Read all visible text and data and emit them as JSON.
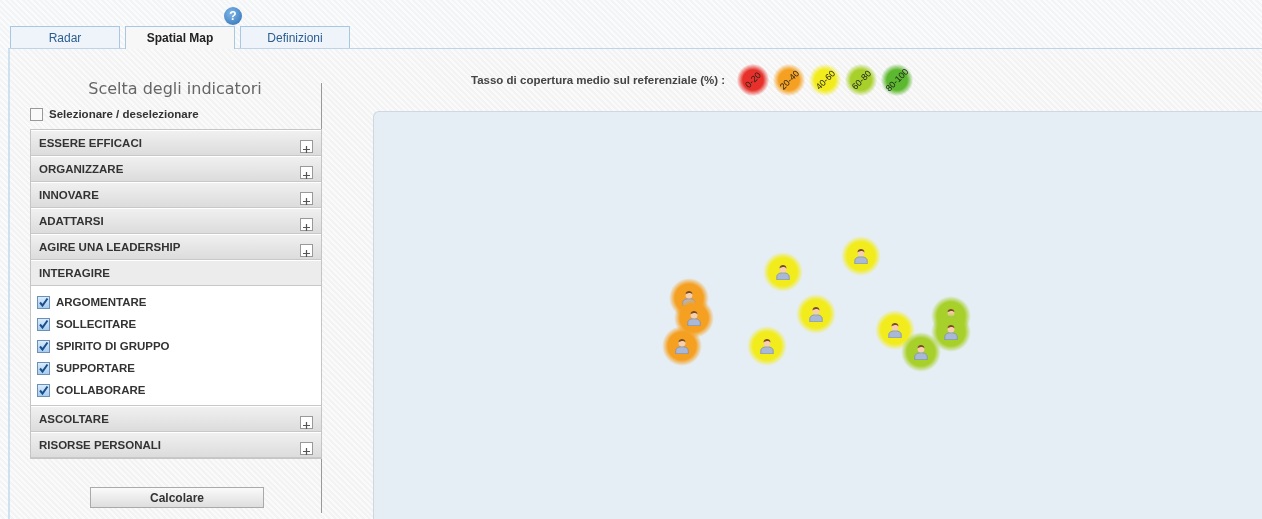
{
  "tabs": [
    {
      "label": "Radar",
      "selected": false
    },
    {
      "label": "Spatial Map",
      "selected": true,
      "help": "?"
    },
    {
      "label": "Definizioni",
      "selected": false
    }
  ],
  "indicators": {
    "title": "Scelta degli indicatori",
    "select_all": {
      "label": "Selezionare / deselezionare",
      "checked": false
    },
    "groups": [
      {
        "label": "ESSERE EFFICACI",
        "expanded": false
      },
      {
        "label": "ORGANIZZARE",
        "expanded": false
      },
      {
        "label": "INNOVARE",
        "expanded": false
      },
      {
        "label": "ADATTARSI",
        "expanded": false
      },
      {
        "label": "AGIRE UNA LEADERSHIP",
        "expanded": false
      },
      {
        "label": "INTERAGIRE",
        "expanded": true,
        "children": [
          {
            "label": "ARGOMENTARE",
            "checked": true
          },
          {
            "label": "SOLLECITARE",
            "checked": true
          },
          {
            "label": "SPIRITO DI GRUPPO",
            "checked": true
          },
          {
            "label": "SUPPORTARE",
            "checked": true
          },
          {
            "label": "COLLABORARE",
            "checked": true
          }
        ]
      },
      {
        "label": "ASCOLTARE",
        "expanded": false
      },
      {
        "label": "RISORSE PERSONALI",
        "expanded": false
      }
    ],
    "button": "Calcolare"
  },
  "map": {
    "legend_label": "Tasso di copertura medio sul referenziale (%) :",
    "legend": [
      {
        "label": "0-20",
        "color": "#e8302a"
      },
      {
        "label": "20-40",
        "color": "#f5a020"
      },
      {
        "label": "40-60",
        "color": "#f2ec1c"
      },
      {
        "label": "60-80",
        "color": "#a8d02a"
      },
      {
        "label": "80-100",
        "color": "#5cb82e"
      }
    ],
    "people": [
      {
        "color": "#f5a020"
      },
      {
        "color": "#f5a020"
      },
      {
        "color": "#f5a020"
      },
      {
        "color": "#f2ec1c"
      },
      {
        "color": "#f2ec1c"
      },
      {
        "color": "#f2ec1c"
      },
      {
        "color": "#f2ec1c"
      },
      {
        "color": "#f2ec1c"
      },
      {
        "color": "#a8d02a"
      },
      {
        "color": "#a8d02a"
      },
      {
        "color": "#a8d02a"
      }
    ]
  }
}
